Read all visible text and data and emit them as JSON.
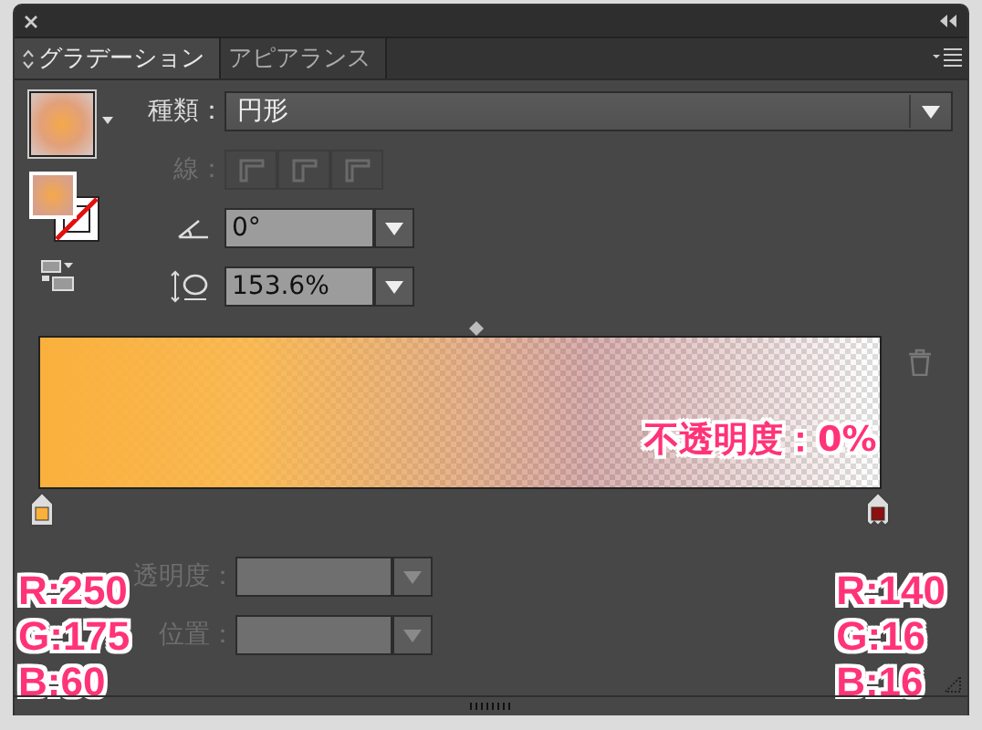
{
  "tabs": [
    {
      "label": "グラデーション",
      "selected": true
    },
    {
      "label": "アピアランス",
      "selected": false
    }
  ],
  "type": {
    "label": "種類：",
    "value": "円形"
  },
  "stroke": {
    "label": "線：",
    "disabled": true
  },
  "angle": {
    "value": "0°"
  },
  "aspect_ratio": {
    "value": "153.6%"
  },
  "gradient": {
    "stops": [
      {
        "color": "#fab03c"
      },
      {
        "color": "#8c1010"
      }
    ]
  },
  "opacity_note": "不透明度：0%",
  "opacity": {
    "label": "透明度：",
    "disabled": true
  },
  "location": {
    "label": "位置：",
    "disabled": true
  },
  "annotations": [
    {
      "lines": [
        "R:250",
        "G:175",
        "B:60"
      ]
    },
    {
      "lines": [
        "R:140",
        "G:16",
        "B:16"
      ]
    }
  ]
}
